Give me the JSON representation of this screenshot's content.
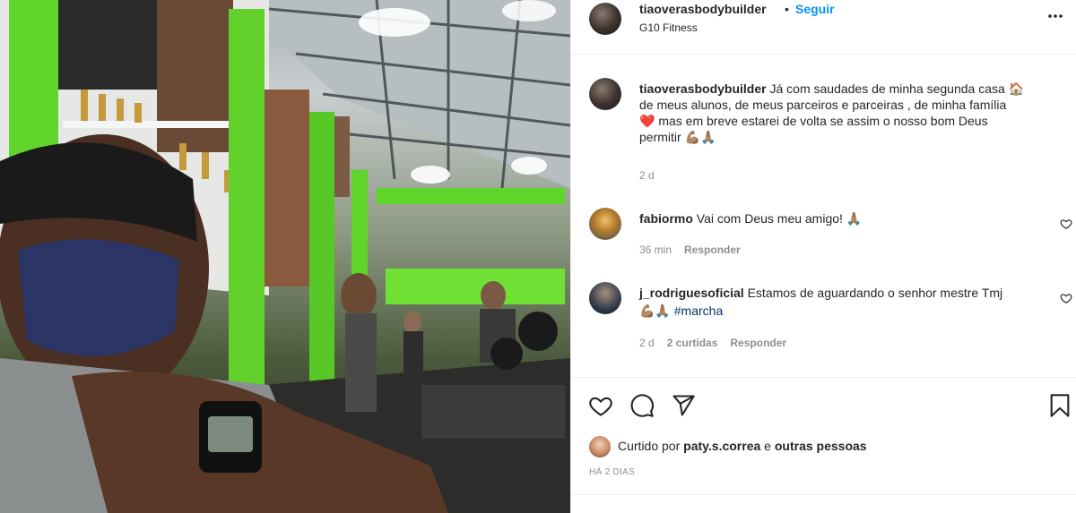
{
  "header": {
    "username": "tiaoverasbodybuilder",
    "separator": "•",
    "follow_label": "Seguir",
    "location": "G10 Fitness"
  },
  "caption": {
    "username": "tiaoverasbodybuilder",
    "text_line1": "Já com saudades de minha segunda casa 🏠",
    "text_line2": "de meus alunos, de meus parceiros e parceiras , de minha família",
    "text_line3": "❤️ mas em breve estarei de volta se assim o nosso bom Deus",
    "text_line4": "permitir 💪🏽🙏🏽",
    "time": "2 d"
  },
  "comments": [
    {
      "username": "fabiormo",
      "text": "Vai com Deus meu amigo! 🙏🏽",
      "time": "36 min",
      "reply_label": "Responder"
    },
    {
      "username": "j_rodriguesoficial",
      "text_line1": "Estamos de aguardando o senhor mestre Tmj",
      "text_line2_emoji": "💪🏽🙏🏽",
      "hashtag": "#marcha",
      "time": "2 d",
      "likes": "2 curtidas",
      "reply_label": "Responder"
    }
  ],
  "likes": {
    "prefix": "Curtido por",
    "user": "paty.s.correa",
    "conjunction": "e",
    "others": "outras pessoas"
  },
  "posted_ago": "HÁ 2 DIAS",
  "icons": {
    "more": "more-options-icon",
    "like": "heart-icon",
    "comment": "comment-icon",
    "share": "share-icon",
    "save": "bookmark-icon"
  },
  "colors": {
    "link_blue": "#0095f6",
    "text": "#262626",
    "muted": "#8e8e8e",
    "gym_green": "#5fd42a"
  }
}
